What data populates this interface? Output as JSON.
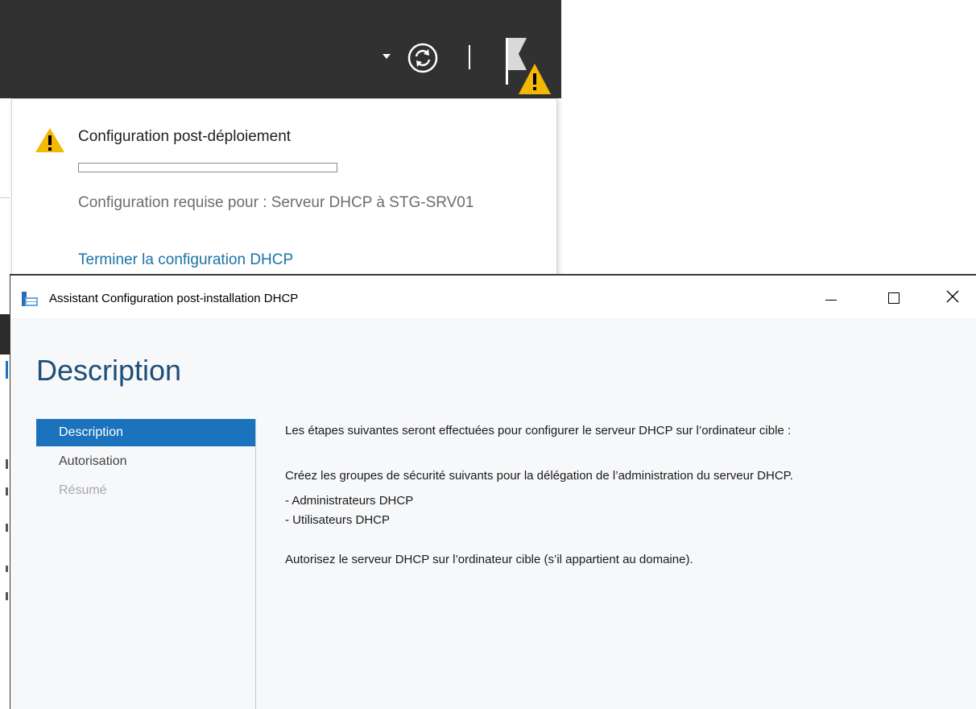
{
  "server_manager": {
    "toolbar": {
      "dropdown_icon": "chevron-down-icon",
      "refresh_icon": "refresh-icon",
      "flag_icon": "notification-flag-icon",
      "warning_badge_icon": "warning-icon"
    }
  },
  "notification": {
    "title": "Configuration post-déploiement",
    "progress": 0,
    "description": "Configuration requise pour : Serveur DHCP à STG-SRV01",
    "link": "Terminer la configuration DHCP",
    "colors": {
      "link": "#1a73a8",
      "warning": "#f5b800"
    }
  },
  "wizard": {
    "title": "Assistant Configuration post-installation DHCP",
    "heading": "Description",
    "nav": [
      {
        "label": "Description",
        "state": "active"
      },
      {
        "label": "Autorisation",
        "state": "normal"
      },
      {
        "label": "Résumé",
        "state": "disabled"
      }
    ],
    "content": {
      "intro": "Les étapes suivantes seront effectuées pour configurer le serveur DHCP sur l’ordinateur cible :",
      "groups_intro": "Créez les groupes de sécurité suivants pour la délégation de l’administration du serveur DHCP.",
      "groups": [
        "- Administrateurs DHCP",
        "- Utilisateurs DHCP"
      ],
      "authorize": "Autorisez le serveur DHCP sur l’ordinateur cible (s’il appartient au domaine)."
    },
    "colors": {
      "accent": "#1a73bc",
      "heading": "#1e4e79"
    }
  }
}
